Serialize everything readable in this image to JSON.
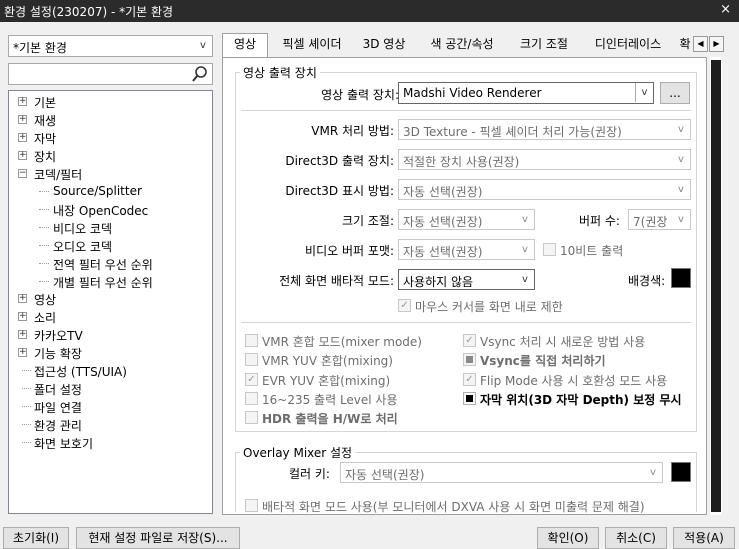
{
  "window": {
    "title": "환경 설정(230207) - *기본 환경",
    "close_symbol": "×"
  },
  "left": {
    "profile": "*기본 환경",
    "search_placeholder": "",
    "tree": [
      {
        "label": "기본",
        "expandable": true,
        "expanded": false
      },
      {
        "label": "재생",
        "expandable": true,
        "expanded": false
      },
      {
        "label": "자막",
        "expandable": true,
        "expanded": false
      },
      {
        "label": "장치",
        "expandable": true,
        "expanded": false
      },
      {
        "label": "코덱/필터",
        "expandable": true,
        "expanded": true
      },
      {
        "label": "Source/Splitter",
        "child": true
      },
      {
        "label": "내장 OpenCodec",
        "child": true
      },
      {
        "label": "비디오 코덱",
        "child": true
      },
      {
        "label": "오디오 코덱",
        "child": true
      },
      {
        "label": "전역 필터 우선 순위",
        "child": true
      },
      {
        "label": "개별 필터 우선 순위",
        "child": true
      },
      {
        "label": "영상",
        "expandable": true,
        "expanded": false
      },
      {
        "label": "소리",
        "expandable": true,
        "expanded": false
      },
      {
        "label": "카카오TV",
        "expandable": true,
        "expanded": false
      },
      {
        "label": "기능 확장",
        "expandable": true,
        "expanded": false
      },
      {
        "label": "접근성 (TTS/UIA)"
      },
      {
        "label": "폴더 설정"
      },
      {
        "label": "파일 연결"
      },
      {
        "label": "환경 관리"
      },
      {
        "label": "화면 보호기"
      }
    ]
  },
  "tabs": [
    "영상",
    "픽셀 셰이더",
    "3D 영상",
    "색 공간/속성",
    "크기 조절",
    "디인터레이스",
    "확"
  ],
  "video_output": {
    "group_title": "영상 출력 장치",
    "device_label": "영상 출력 장치:",
    "device_value": "Madshi Video Renderer",
    "more_button": "...",
    "vmr_label": "VMR 처리 방법:",
    "vmr_value": "3D Texture - 픽셀 셰이더 처리 가능(권장)",
    "d3d_device_label": "Direct3D 출력 장치:",
    "d3d_device_value": "적절한 장치 사용(권장)",
    "d3d_display_label": "Direct3D 표시 방법:",
    "d3d_display_value": "자동 선택(권장)",
    "resize_label": "크기 조절:",
    "resize_value": "자동 선택(권장)",
    "buffer_label": "버퍼 수:",
    "buffer_value": "7(권장",
    "video_buffer_label": "비디오 버퍼 포맷:",
    "video_buffer_value": "자동 선택(권장)",
    "ten_bit_label": "10비트 출력",
    "fullscreen_label": "전체 화면 배타적 모드:",
    "fullscreen_value": "사용하지 않음",
    "bg_color_label": "배경색:",
    "bg_color": "#000000",
    "mouse_limit_label": "마우스 커서를 화면 내로 제한",
    "options": [
      {
        "label": "VMR 혼합 모드(mixer mode)",
        "checked": false,
        "disabled": true
      },
      {
        "label": "Vsync 처리 시 새로운 방법 사용",
        "checked": true,
        "disabled": true
      },
      {
        "label": "VMR YUV 혼합(mixing)",
        "checked": false,
        "disabled": true
      },
      {
        "label": "Vsync를 직접 처리하기",
        "checked": "partial",
        "disabled": true,
        "bold": true
      },
      {
        "label": "EVR YUV 혼합(mixing)",
        "checked": true,
        "disabled": true
      },
      {
        "label": "Flip Mode 사용 시 호환성 모드 사용",
        "checked": true,
        "disabled": true
      },
      {
        "label": "16~235 출력 Level 사용",
        "checked": false,
        "disabled": true
      },
      {
        "label": "자막 위치(3D 자막 Depth) 보정 무시",
        "checked": "partial",
        "disabled": false,
        "bold": true
      },
      {
        "label": "HDR 출력을 H/W로 처리",
        "checked": false,
        "disabled": true,
        "bold": true
      }
    ]
  },
  "overlay": {
    "group_title": "Overlay Mixer 설정",
    "color_key_label": "컬러 키:",
    "color_key_value": "자동 선택(권장)",
    "color_key_swatch": "#000000",
    "exclusive_label": "배타적 화면 모드 사용(부 모니터에서 DXVA 사용 시 화면 미출력 문제 해결)"
  },
  "footer": {
    "reset": "초기화(I)",
    "save_as": "현재 설정 파일로 저장(S)...",
    "ok": "확인(O)",
    "cancel": "취소(C)",
    "apply": "적용(A)"
  }
}
